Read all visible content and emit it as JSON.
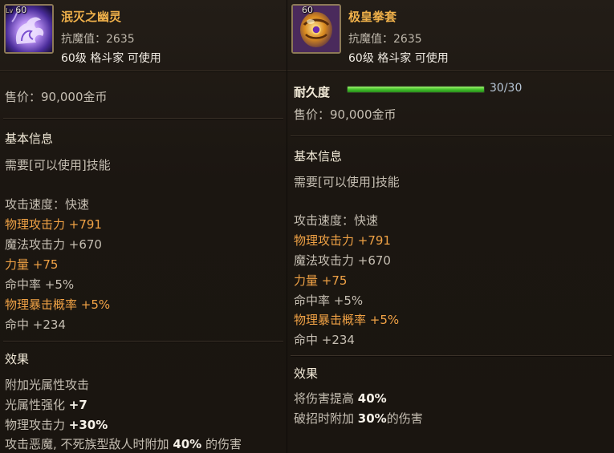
{
  "left": {
    "level": "60",
    "level_prefix": "Lv",
    "name": "泯灭之幽灵",
    "resist": "抗魔值：2635",
    "usable": "60级 格斗家 可使用",
    "price": "售价：90,000金币",
    "basic_title": "基本信息",
    "skill_req": "需要[可以使用]技能",
    "attack_speed": "攻击速度：快速",
    "phys_attack": "物理攻击力 +791",
    "magic_attack": "魔法攻击力 +670",
    "strength": "力量 +75",
    "hit_rate": "命中率 +5%",
    "crit": "物理暴击概率 +5%",
    "hit": "命中 +234",
    "effect_title": "效果",
    "effect1": "附加光属性攻击",
    "effect2_prefix": "光属性强化 ",
    "effect2_value": "+7",
    "effect3_prefix": "物理攻击力 ",
    "effect3_value": "+30%",
    "effect4_prefix": "攻击恶魔, 不死族型敌人时附加 ",
    "effect4_value": "40%",
    "effect4_suffix": " 的伤害"
  },
  "right": {
    "level": "60",
    "name": "极皇拳套",
    "resist": "抗魔值：2635",
    "usable": "60级 格斗家 可使用",
    "durability_label": "耐久度",
    "durability_value": "30/30",
    "durability_fraction": 1.0,
    "price": "售价：90,000金币",
    "basic_title": "基本信息",
    "skill_req": "需要[可以使用]技能",
    "attack_speed": "攻击速度：快速",
    "phys_attack": "物理攻击力 +791",
    "magic_attack": "魔法攻击力 +670",
    "strength": "力量 +75",
    "hit_rate": "命中率 +5%",
    "crit": "物理暴击概率 +5%",
    "hit": "命中 +234",
    "effect_title": "效果",
    "effect1_prefix": "将伤害提高 ",
    "effect1_value": "40%",
    "effect2_prefix": "破招时附加 ",
    "effect2_value": "30%",
    "effect2_suffix": "的伤害"
  },
  "colors": {
    "background": "#1c1712",
    "item_name": "#efb04a",
    "highlight": "#f0a245",
    "durability_bar": "#3fbf2a"
  },
  "icons": {
    "left_item": "ghost-fist-icon",
    "right_item": "gauntlet-icon"
  }
}
